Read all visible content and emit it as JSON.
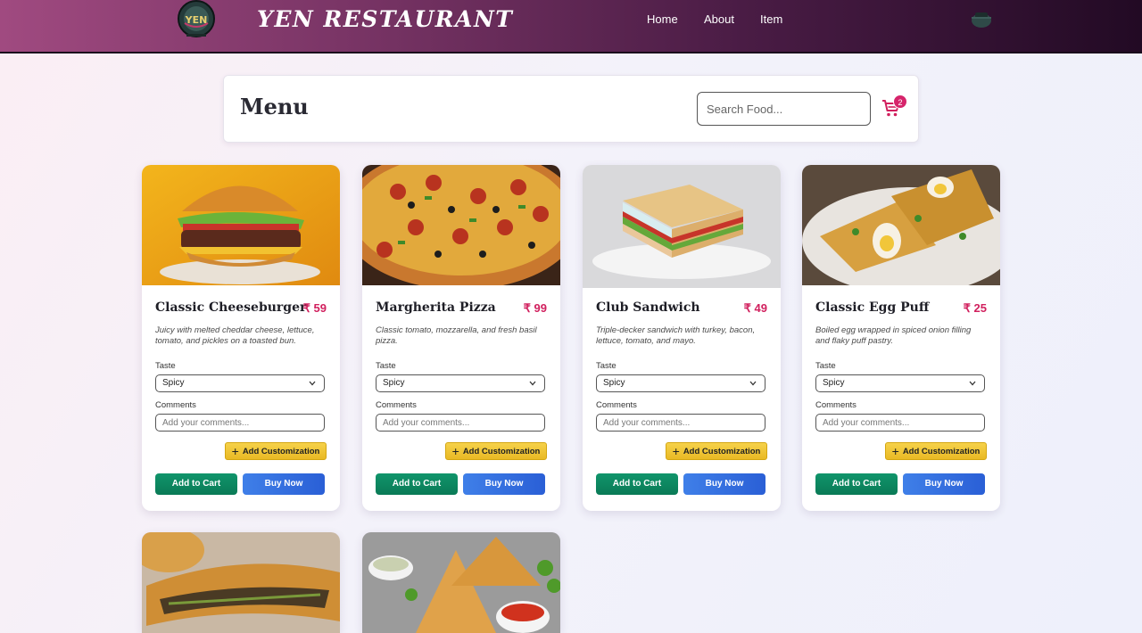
{
  "header": {
    "brand": "YEN RESTAURANT",
    "logo_text": "YEN",
    "nav": [
      "Home",
      "About",
      "Item"
    ]
  },
  "menu": {
    "title": "Menu",
    "search_placeholder": "Search Food...",
    "cart_count": "2"
  },
  "labels": {
    "taste": "Taste",
    "comments": "Comments",
    "comment_placeholder": "Add your comments...",
    "add_customization": "Add Customization",
    "add_to_cart": "Add to Cart",
    "buy_now": "Buy Now"
  },
  "items": [
    {
      "name": "Classic Cheeseburger",
      "price": "₹ 59",
      "description": "Juicy with melted cheddar cheese, lettuce, tomato, and pickles on a toasted bun.",
      "taste": "Spicy"
    },
    {
      "name": "Margherita Pizza",
      "price": "₹ 99",
      "description": "Classic tomato, mozzarella, and fresh basil pizza.",
      "taste": "Spicy"
    },
    {
      "name": "Club Sandwich",
      "price": "₹ 49",
      "description": "Triple-decker sandwich with turkey, bacon, lettuce, tomato, and mayo.",
      "taste": "Spicy"
    },
    {
      "name": "Classic Egg Puff",
      "price": "₹ 25",
      "description": "Boiled egg wrapped in spiced onion filling and flaky puff pastry.",
      "taste": "Spicy"
    }
  ],
  "colors": {
    "accent_price": "#d1205e",
    "add_to_cart": "#0a7a56",
    "buy_now": "#2a5fd6",
    "customize": "#e9b924"
  }
}
